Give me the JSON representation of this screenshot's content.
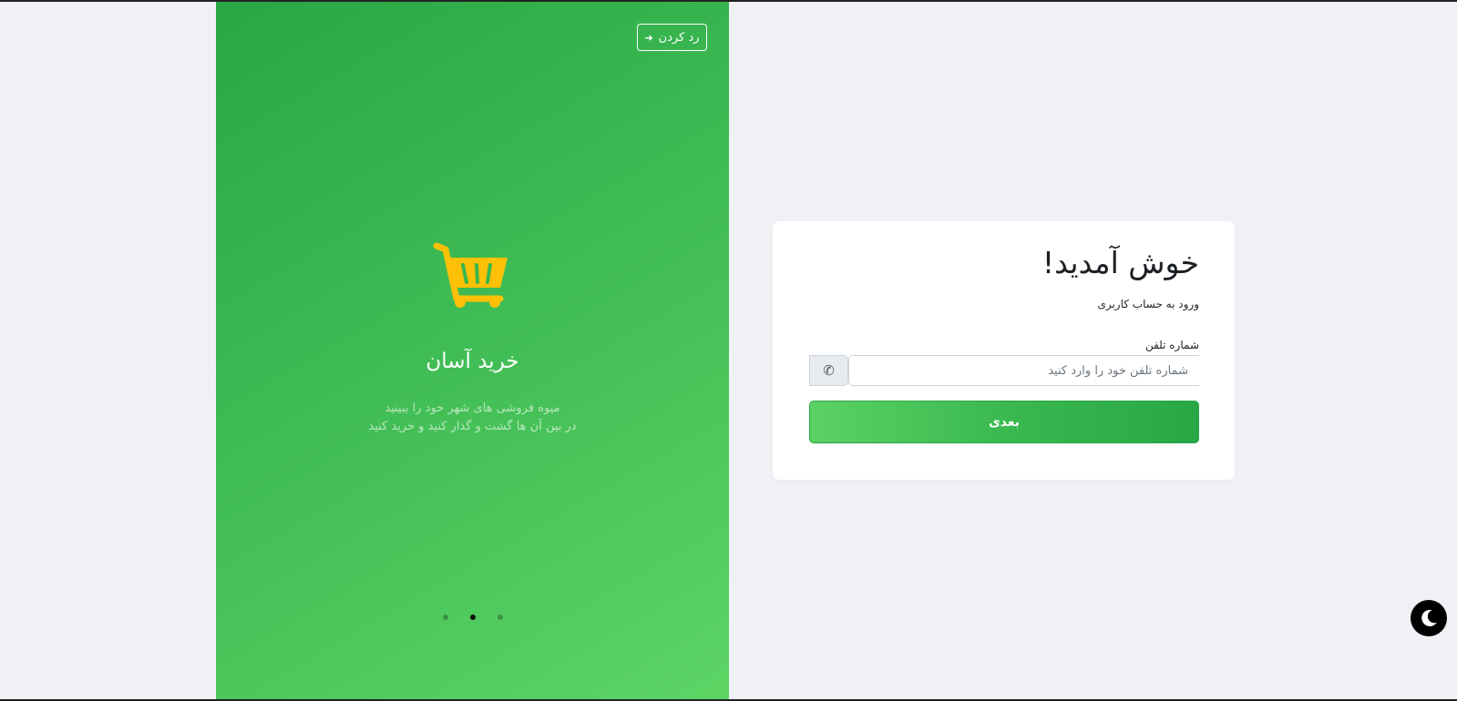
{
  "promo": {
    "skip_label": "رد کردن",
    "skip_icon": "arrow-right-icon",
    "cart_icon": "shopping-cart-icon",
    "cart_color": "#ffc107",
    "title": "خرید آسان",
    "description_line1": "میوه فروشی های شهر خود را ببینید",
    "description_line2": "در بین آن ها گشت و گذار کنید و خرید کنید",
    "slides_total": 3,
    "active_slide": 2
  },
  "login": {
    "title": "خوش آمدید!",
    "subtitle": "ورود به حساب کاربری",
    "phone_label": "شماره تلفن",
    "phone_placeholder": "شماره تلفن خود را وارد کنید",
    "phone_value": "",
    "phone_icon": "phone-icon",
    "next_label": "بعدی"
  },
  "theme_toggle": {
    "icon": "moon-icon"
  },
  "colors": {
    "brand_green": "#28a745",
    "brand_green_light": "#5cd565",
    "accent_yellow": "#ffc107"
  }
}
